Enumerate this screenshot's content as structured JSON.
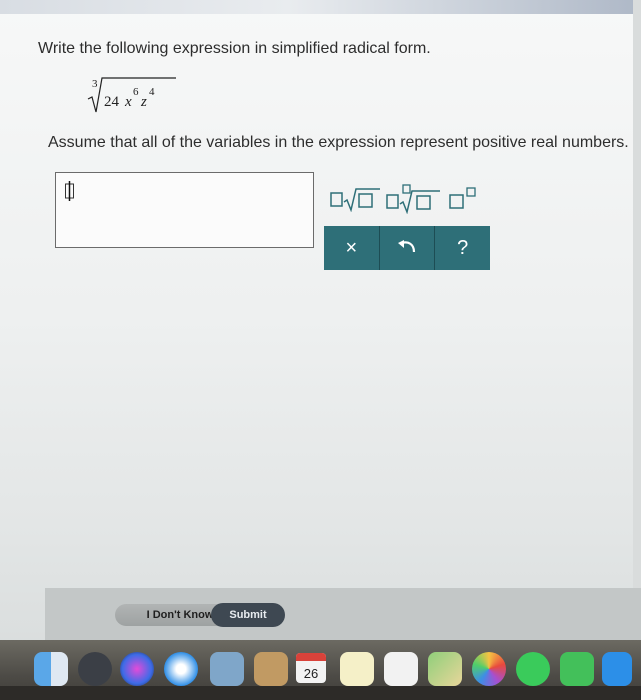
{
  "question": {
    "prompt": "Write the following expression in simplified radical form.",
    "expression": {
      "index": "3",
      "coefficient": "24",
      "var1": "x",
      "exp1": "6",
      "var2": "z",
      "exp2": "4"
    },
    "assumption": "Assume that all of the variables in the expression represent positive real numbers."
  },
  "answer": {
    "value": ""
  },
  "math_toolbar": {
    "tools": [
      {
        "icon": "coefficient-sqrt-icon"
      },
      {
        "icon": "coefficient-nth-root-icon"
      },
      {
        "icon": "exponent-icon"
      }
    ],
    "actions": [
      {
        "label": "×",
        "icon": "clear-icon"
      },
      {
        "label": "",
        "icon": "undo-icon"
      },
      {
        "label": "?",
        "icon": "help-icon"
      }
    ]
  },
  "buttons": {
    "dont_know": "I Don't Know",
    "submit": "Submit"
  },
  "dock": {
    "calendar_day": "26",
    "apps": [
      "finder-icon",
      "launchpad-icon",
      "siri-icon",
      "safari-icon",
      "preview-icon",
      "notes-icon",
      "calendar-icon",
      "reminders-icon",
      "maps-icon",
      "photos-icon",
      "messages-icon",
      "facetime-icon",
      "app-store-icon"
    ]
  },
  "colors": {
    "toolbar": "#2e6f78",
    "submit": "#3e4852"
  }
}
